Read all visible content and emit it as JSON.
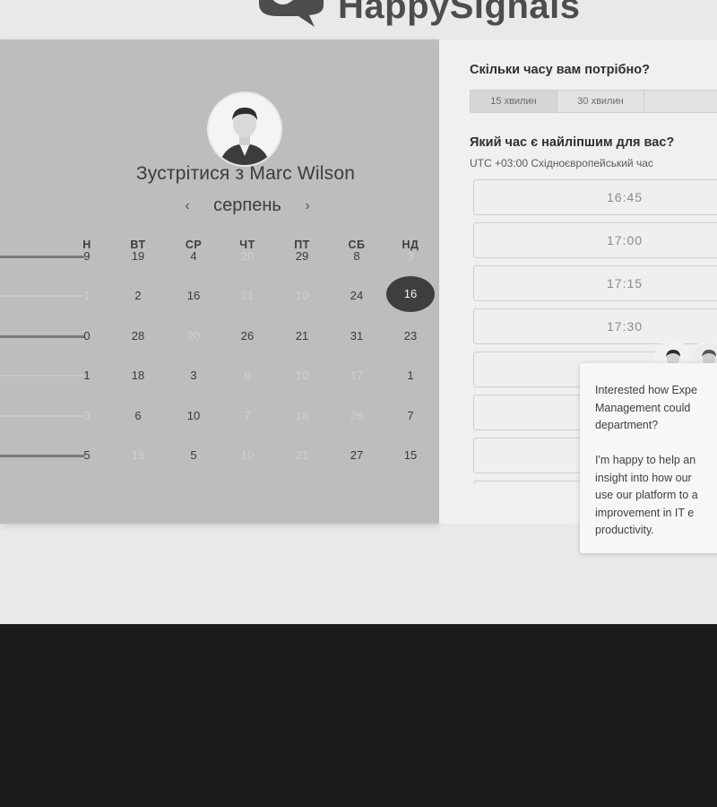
{
  "brand": {
    "name": "HappySignals"
  },
  "calendar": {
    "title": "Зустрітися з Marc Wilson",
    "month": "серпень",
    "prev_icon": "chevron-left-icon",
    "next_icon": "chevron-right-icon",
    "weekdays": [
      "Н",
      "ВТ",
      "СР",
      "ЧТ",
      "ПТ",
      "СБ",
      "НД"
    ],
    "rows": [
      [
        {
          "v": "9",
          "d": false
        },
        {
          "v": "19",
          "d": false
        },
        {
          "v": "4",
          "d": false
        },
        {
          "v": "20",
          "d": true
        },
        {
          "v": "29",
          "d": false
        },
        {
          "v": "8",
          "d": false
        },
        {
          "v": "3",
          "d": true
        }
      ],
      [
        {
          "v": "1",
          "d": true
        },
        {
          "v": "2",
          "d": false
        },
        {
          "v": "16",
          "d": false
        },
        {
          "v": "21",
          "d": true
        },
        {
          "v": "10",
          "d": true
        },
        {
          "v": "24",
          "d": false
        },
        {
          "v": "16",
          "d": false,
          "selected": true
        }
      ],
      [
        {
          "v": "0",
          "d": false
        },
        {
          "v": "28",
          "d": false
        },
        {
          "v": "20",
          "d": true
        },
        {
          "v": "26",
          "d": false
        },
        {
          "v": "21",
          "d": false
        },
        {
          "v": "31",
          "d": false
        },
        {
          "v": "23",
          "d": false
        }
      ],
      [
        {
          "v": "1",
          "d": false
        },
        {
          "v": "18",
          "d": false
        },
        {
          "v": "3",
          "d": false
        },
        {
          "v": "6",
          "d": true
        },
        {
          "v": "10",
          "d": true
        },
        {
          "v": "17",
          "d": true
        },
        {
          "v": "1",
          "d": false
        }
      ],
      [
        {
          "v": "3",
          "d": true
        },
        {
          "v": "6",
          "d": false
        },
        {
          "v": "10",
          "d": false
        },
        {
          "v": "7",
          "d": true
        },
        {
          "v": "18",
          "d": true
        },
        {
          "v": "26",
          "d": true
        },
        {
          "v": "7",
          "d": false
        }
      ],
      [
        {
          "v": "5",
          "d": false
        },
        {
          "v": "16",
          "d": true
        },
        {
          "v": "5",
          "d": false
        },
        {
          "v": "10",
          "d": true
        },
        {
          "v": "21",
          "d": true
        },
        {
          "v": "27",
          "d": false
        },
        {
          "v": "15",
          "d": false
        }
      ]
    ]
  },
  "booking": {
    "duration_question": "Скільки часу вам потрібно?",
    "durations": [
      "15 хвилин",
      "30 хвилин",
      ""
    ],
    "time_question": "Який час є найліпшим для вас?",
    "timezone": "UTC +03:00 Східноєвропейський час",
    "slots": [
      "16:45",
      "17:00",
      "17:15",
      "17:30",
      "",
      "",
      "",
      ""
    ]
  },
  "chat": {
    "lines": [
      "Interested how Expe",
      "Management could",
      "department?",
      "",
      "I'm happy to help an",
      "insight into how our",
      "use our platform to a",
      "improvement in IT e",
      "productivity."
    ]
  }
}
